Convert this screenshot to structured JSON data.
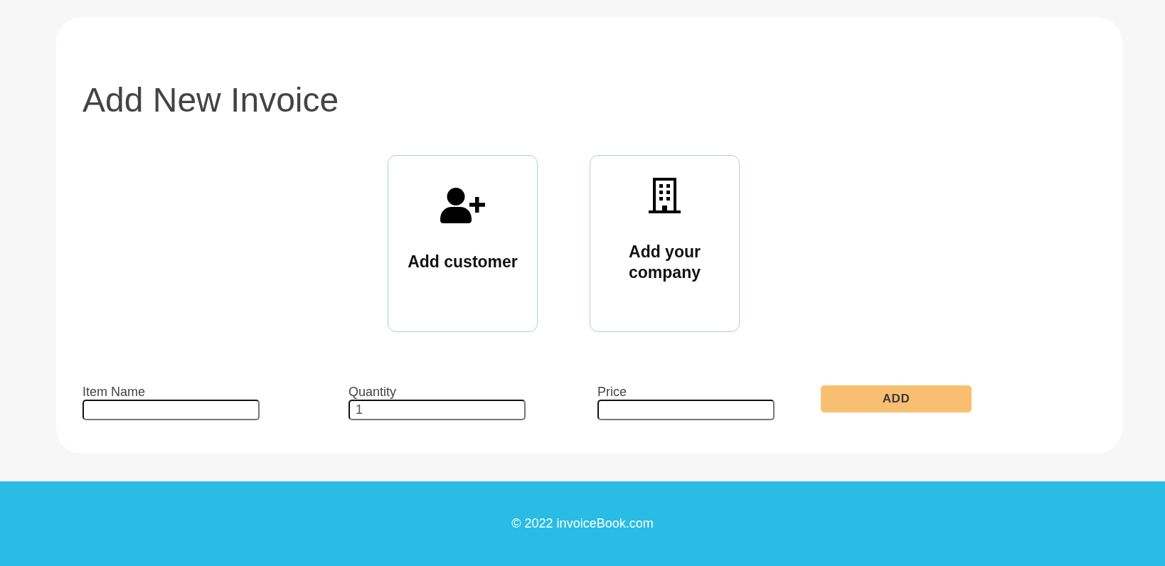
{
  "page": {
    "title": "Add New Invoice"
  },
  "cards": [
    {
      "kind": "customer",
      "label": "Add customer"
    },
    {
      "kind": "company",
      "label": "Add your company"
    }
  ],
  "form": {
    "fields": [
      {
        "label": "Item Name"
      },
      {
        "label": "Quantity",
        "value": "1"
      },
      {
        "label": "Price"
      }
    ],
    "button": "ADD"
  },
  "footer": {
    "text": "© 2022 invoiceBook.com"
  }
}
